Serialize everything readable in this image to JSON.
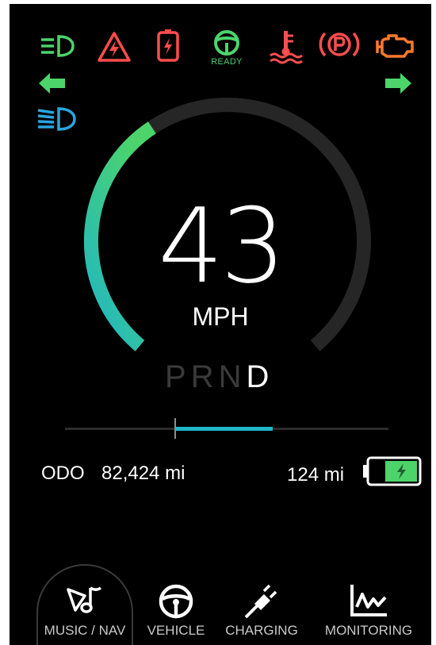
{
  "telltales": {
    "ready_text": "READY"
  },
  "gauge": {
    "speed_value": "43",
    "speed_unit": "MPH",
    "speed_fraction": 0.38
  },
  "gear_selector": {
    "gears": [
      "P",
      "R",
      "N",
      "D"
    ],
    "active": "D"
  },
  "power_meter": {
    "level_fraction": 0.3
  },
  "stats": {
    "odo_label": "ODO",
    "odo_value": "82,424 mi",
    "range_value": "124 mi"
  },
  "bottom_nav": {
    "items": [
      {
        "label": "MUSIC / NAV",
        "icon": "music-nav-icon",
        "active": true
      },
      {
        "label": "VEHICLE",
        "icon": "steering-wheel-icon",
        "active": false
      },
      {
        "label": "CHARGING",
        "icon": "plug-icon",
        "active": false
      },
      {
        "label": "MONITORING",
        "icon": "line-chart-icon",
        "active": false
      }
    ]
  },
  "colors": {
    "green": "#4cd46b",
    "red": "#ff4d4d",
    "orange": "#ff7a2e",
    "cyan": "#1fb6c7",
    "blue": "#2aa5e0",
    "background": "#000000"
  }
}
